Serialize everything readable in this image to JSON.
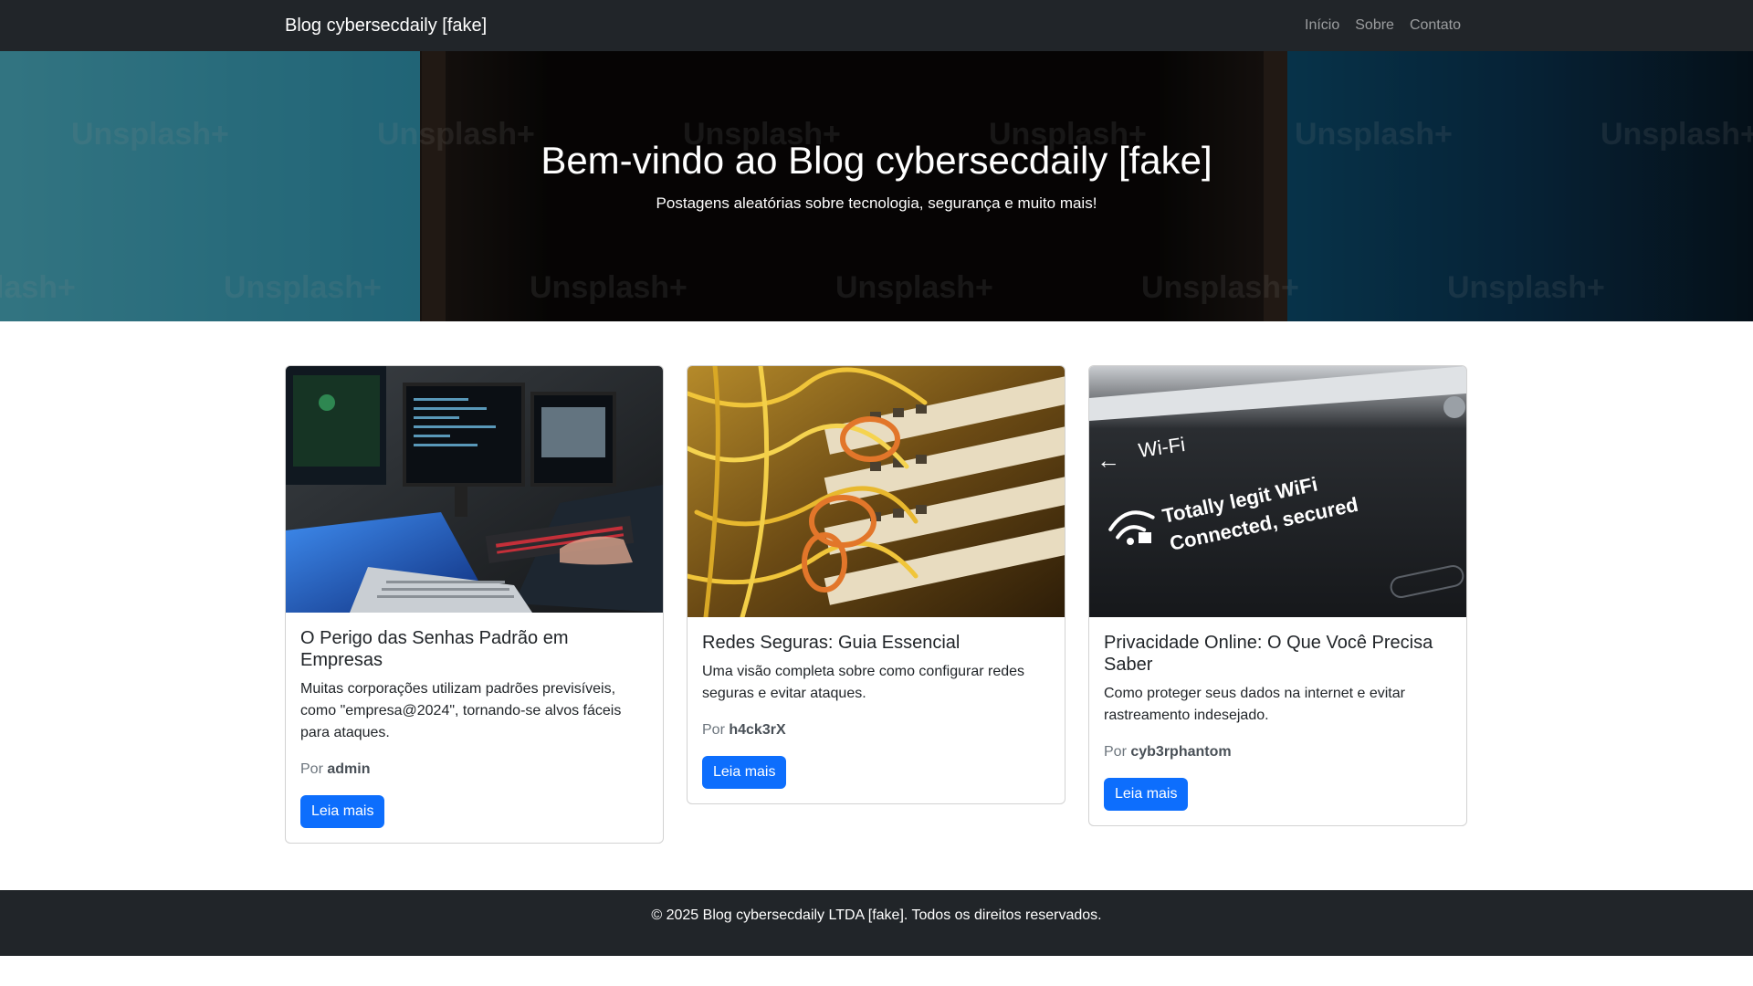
{
  "navbar": {
    "brand": "Blog cybersecdaily [fake]",
    "links": [
      {
        "label": "Início"
      },
      {
        "label": "Sobre"
      },
      {
        "label": "Contato"
      }
    ]
  },
  "hero": {
    "title": "Bem-vindo ao Blog cybersecdaily [fake]",
    "subtitle": "Postagens aleatórias sobre tecnologia, segurança e muito mais!",
    "watermark": "Unsplash+"
  },
  "posts": [
    {
      "title": "O Perigo das Senhas Padrão em Empresas",
      "summary": "Muitas corporações utilizam padrões previsíveis, como \"empresa@2024\", tornando-se alvos fáceis para ataques.",
      "author_prefix": "Por",
      "author": "admin",
      "button": "Leia mais",
      "image": "hacker-workstation-image"
    },
    {
      "title": "Redes Seguras: Guia Essencial",
      "summary": "Uma visão completa sobre como configurar redes seguras e evitar ataques.",
      "author_prefix": "Por",
      "author": "h4ck3rX",
      "button": "Leia mais",
      "image": "network-cables-image"
    },
    {
      "title": "Privacidade Online: O Que Você Precisa Saber",
      "summary": "Como proteger seus dados na internet e evitar rastreamento indesejado.",
      "author_prefix": "Por",
      "author": "cyb3rphantom",
      "button": "Leia mais",
      "image": "wifi-screen-image",
      "image_text": {
        "header": "Wi-Fi",
        "line1": "Totally legit WiFi",
        "line2": "Connected, secured"
      }
    }
  ],
  "footer": {
    "text": "© 2025 Blog cybersecdaily LTDA [fake]. Todos os direitos reservados."
  },
  "colors": {
    "navbar_bg": "#212529",
    "primary": "#0d6efd",
    "muted": "#6c757d"
  }
}
